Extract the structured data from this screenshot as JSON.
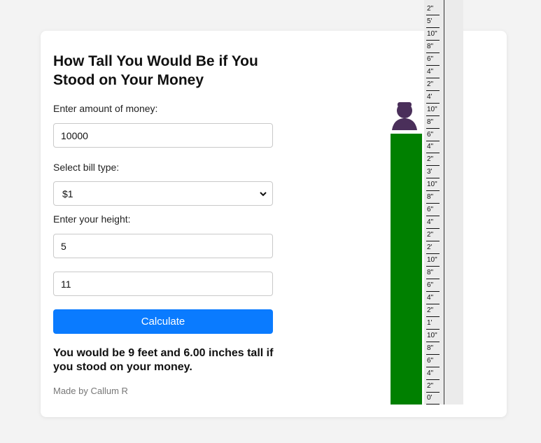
{
  "form": {
    "title": "How Tall You Would Be if You Stood on Your Money",
    "money_label": "Enter amount of money:",
    "money_value": "10000",
    "bill_label": "Select bill type:",
    "bill_selected": "$1",
    "height_label": "Enter your height:",
    "height_feet": "5",
    "height_inches": "11",
    "calculate_label": "Calculate",
    "result": "You would be 9 feet and 6.00 inches tall if you stood on your money.",
    "credit": "Made by Callum R"
  },
  "visual": {
    "stack_color": "#008000",
    "person_color": "#4a2f5a",
    "button_color": "#0a7bff"
  },
  "ruler": {
    "ticks": [
      "2\"",
      "5'",
      "10\"",
      "8\"",
      "6\"",
      "4\"",
      "2\"",
      "4'",
      "10\"",
      "8\"",
      "6\"",
      "4\"",
      "2\"",
      "3'",
      "10\"",
      "8\"",
      "6\"",
      "4\"",
      "2\"",
      "2'",
      "10\"",
      "8\"",
      "6\"",
      "4\"",
      "2\"",
      "1'",
      "10\"",
      "8\"",
      "6\"",
      "4\"",
      "2\"",
      "0'"
    ]
  }
}
